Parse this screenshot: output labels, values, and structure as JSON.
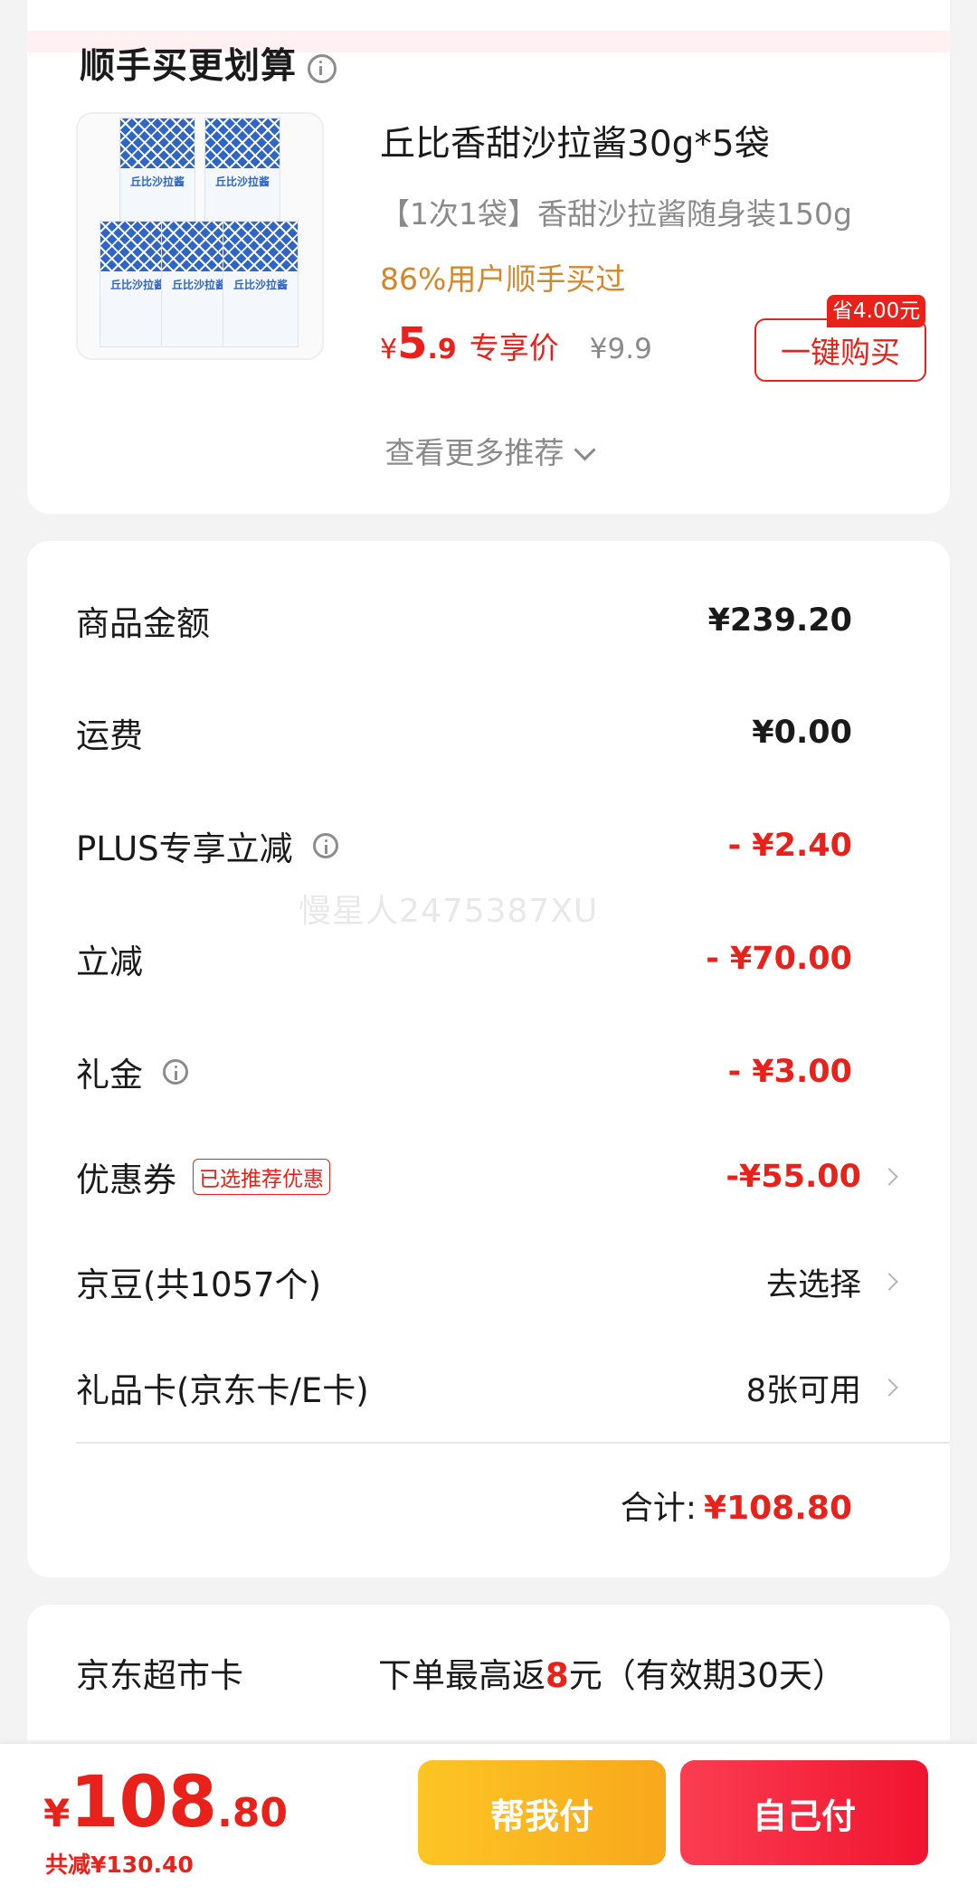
{
  "recommend": {
    "title": "顺手买更划算",
    "product": {
      "name": "丘比香甜沙拉酱30g*5袋",
      "subtitle": "【1次1袋】香甜沙拉酱随身装150g",
      "social": "86%用户顺手买过",
      "price_symbol": "¥",
      "price_int": "5",
      "price_dec": ".9",
      "price_label": "专享价",
      "original_price": "¥9.9",
      "save_tag": "省4.00元",
      "buy_button": "一键购买",
      "thumb_text": "丘比沙拉酱"
    },
    "more_link": "查看更多推荐"
  },
  "summary": {
    "rows": [
      {
        "label": "商品金额",
        "value": "¥239.20"
      },
      {
        "label": "运费",
        "value": "¥0.00"
      },
      {
        "label": "PLUS专享立减",
        "value": "- ¥2.40"
      },
      {
        "label": "立减",
        "value": "- ¥70.00"
      },
      {
        "label": "礼金",
        "value": "- ¥3.00"
      },
      {
        "label": "优惠券",
        "badge": "已选推荐优惠",
        "value": "-¥55.00"
      },
      {
        "label": "京豆(共1057个)",
        "value": "去选择"
      },
      {
        "label": "礼品卡(京东卡/E卡)",
        "value": "8张可用"
      }
    ],
    "total_label": "合计:",
    "total_value": "¥108.80"
  },
  "jd_card": {
    "title": "京东超市卡",
    "desc_prefix": "下单最高返",
    "desc_amount": "8",
    "desc_suffix": "元（有效期30天）"
  },
  "watermark": "慢星人2475387XU",
  "bottom": {
    "price_symbol": "¥",
    "price_int": "108",
    "price_dec": ".80",
    "saved": "共减¥130.40",
    "help_pay": "帮我付",
    "self_pay": "自己付"
  },
  "colors": {
    "accent_red": "#e8221b",
    "social_orange": "#d4862a",
    "help_button": "#fdc525"
  }
}
